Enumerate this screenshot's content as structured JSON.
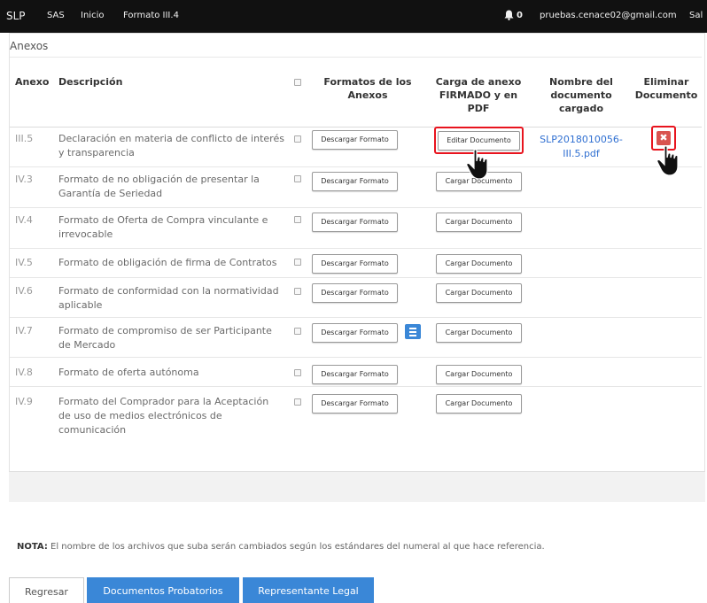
{
  "navbar": {
    "brand": "SLP",
    "links": [
      "SAS",
      "Inicio",
      "Formato III.4"
    ],
    "notifications_count": "0",
    "user_email": "pruebas.cenace02@gmail.com",
    "logout_label": "Sal"
  },
  "panel": {
    "title": "Anexos"
  },
  "table": {
    "headers": {
      "anexo": "Anexo",
      "descripcion": "Descripción",
      "formatos_line1": "Formatos de los",
      "formatos_line2": "Anexos",
      "carga_line1": "Carga de anexo",
      "carga_line2": "FIRMADO y en",
      "carga_line3": "PDF",
      "nombre_line1": "Nombre del",
      "nombre_line2": "documento",
      "nombre_line3": "cargado",
      "eliminar_line1": "Eliminar",
      "eliminar_line2": "Documento"
    },
    "rows": [
      {
        "code": "III.5",
        "desc_1": "Declaración en materia de conflicto de interés",
        "desc_2": "y transparencia",
        "download": "Descargar Formato",
        "upload": "Editar Documento",
        "doc_line1": "SLP2018010056-",
        "doc_line2": "III.5.pdf"
      },
      {
        "code": "IV.3",
        "desc_1": "Formato de no obligación de presentar la",
        "desc_2": "Garantía de Seriedad",
        "download": "Descargar Formato",
        "upload": "Cargar Documento"
      },
      {
        "code": "IV.4",
        "desc_1": "Formato de Oferta de Compra vinculante e",
        "desc_2": "irrevocable",
        "download": "Descargar Formato",
        "upload": "Cargar Documento"
      },
      {
        "code": "IV.5",
        "desc_1": "Formato de obligación de firma de Contratos",
        "download": "Descargar Formato",
        "upload": "Cargar Documento"
      },
      {
        "code": "IV.6",
        "desc_1": "Formato de conformidad con la normatividad",
        "desc_2": "aplicable",
        "download": "Descargar Formato",
        "upload": "Cargar Documento"
      },
      {
        "code": "IV.7",
        "desc_1": "Formato de compromiso de ser Participante",
        "desc_2": "de Mercado",
        "download": "Descargar Formato",
        "upload": "Cargar Documento"
      },
      {
        "code": "IV.8",
        "desc_1": "Formato de oferta autónoma",
        "download": "Descargar Formato",
        "upload": "Cargar Documento"
      },
      {
        "code": "IV.9",
        "desc_1": "Formato del Comprador para la Aceptación",
        "desc_2": "de uso de medios electrónicos de",
        "desc_3": "comunicación",
        "download": "Descargar Formato",
        "upload": "Cargar Documento"
      }
    ],
    "delete_glyph": "✖"
  },
  "note": {
    "label": "NOTA:",
    "text": " El nombre de los archivos que suba serán cambiados según los estándares del numeral al que hace referencia."
  },
  "buttons": {
    "back": "Regresar",
    "probatorios": "Documentos Probatorios",
    "representante": "Representante Legal"
  },
  "colors": {
    "navbar_bg": "#111111",
    "primary": "#3a87d7",
    "link": "#2f6fd1",
    "danger": "#d9534f",
    "highlight": "#e8141e"
  }
}
